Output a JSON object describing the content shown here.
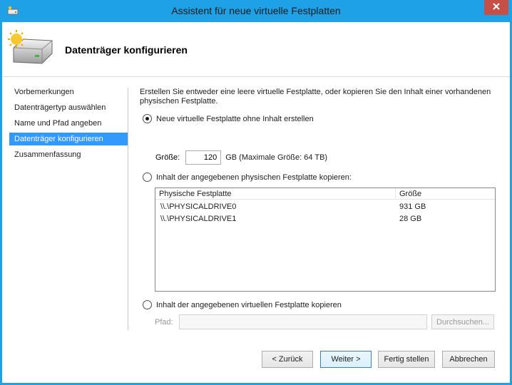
{
  "window": {
    "title": "Assistent für neue virtuelle Festplatten"
  },
  "header": {
    "title": "Datenträger konfigurieren"
  },
  "nav": {
    "items": [
      {
        "label": "Vorbemerkungen"
      },
      {
        "label": "Datenträgertyp auswählen"
      },
      {
        "label": "Name und Pfad angeben"
      },
      {
        "label": "Datenträger konfigurieren",
        "active": true
      },
      {
        "label": "Zusammenfassung"
      }
    ]
  },
  "main": {
    "description": "Erstellen Sie entweder eine leere virtuelle Festplatte, oder kopieren Sie den Inhalt einer vorhandenen physischen Festplatte.",
    "option_new": {
      "label": "Neue virtuelle Festplatte ohne Inhalt erstellen",
      "checked": true
    },
    "size": {
      "label": "Größe:",
      "value": "120",
      "unit": "GB (Maximale Größe: 64 TB)"
    },
    "option_physical": {
      "label": "Inhalt der angegebenen physischen Festplatte kopieren:",
      "checked": false
    },
    "disk_table": {
      "columns": [
        "Physische Festplatte",
        "Größe"
      ],
      "rows": [
        [
          "\\\\.\\PHYSICALDRIVE0",
          "931 GB"
        ],
        [
          "\\\\.\\PHYSICALDRIVE1",
          "28 GB"
        ]
      ]
    },
    "option_virtual": {
      "label": "Inhalt der angegebenen virtuellen Festplatte kopieren",
      "checked": false
    },
    "path": {
      "label": "Pfad:",
      "value": "",
      "browse_label": "Durchsuchen..."
    }
  },
  "footer": {
    "back_label": "< Zurück",
    "next_label": "Weiter >",
    "finish_label": "Fertig stellen",
    "cancel_label": "Abbrechen"
  },
  "colors": {
    "titlebar": "#1ea1e6",
    "close_button": "#c74f48",
    "nav_active": "#3399ff"
  }
}
